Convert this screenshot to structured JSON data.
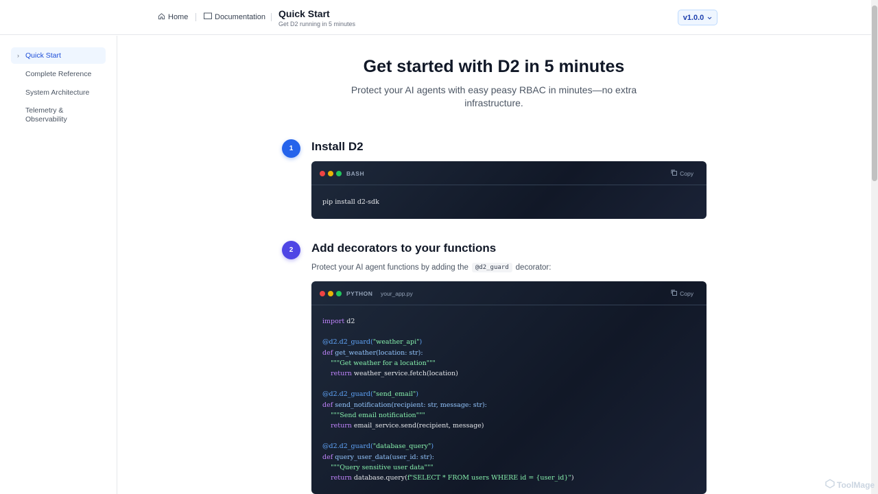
{
  "header": {
    "home_label": "Home",
    "docs_label": "Documentation",
    "title": "Quick Start",
    "subtitle": "Get D2 running in 5 minutes",
    "version": "v1.0.0"
  },
  "sidebar": {
    "items": [
      {
        "label": "Quick Start",
        "active": true
      },
      {
        "label": "Complete Reference",
        "active": false
      },
      {
        "label": "System Architecture",
        "active": false
      },
      {
        "label": "Telemetry & Observability",
        "active": false
      }
    ]
  },
  "hero": {
    "title": "Get started with D2 in 5 minutes",
    "subtitle": "Protect your AI agents with easy peasy RBAC in minutes—no extra infrastructure."
  },
  "steps": [
    {
      "number": "1",
      "title": "Install D2",
      "lang": "BASH",
      "copy_label": "Copy",
      "code": "pip install d2-sdk"
    },
    {
      "number": "2",
      "title": "Add decorators to your functions",
      "desc_before": "Protect your AI agent functions by adding the",
      "desc_code": "@d2_guard",
      "desc_after": "decorator:",
      "lang": "PYTHON",
      "filename": "your_app.py",
      "copy_label": "Copy"
    }
  ],
  "colors": {
    "accent": "#2563eb",
    "step2_accent": "#4f46e5",
    "code_bg": "#111827"
  },
  "watermark": "ToolMage"
}
